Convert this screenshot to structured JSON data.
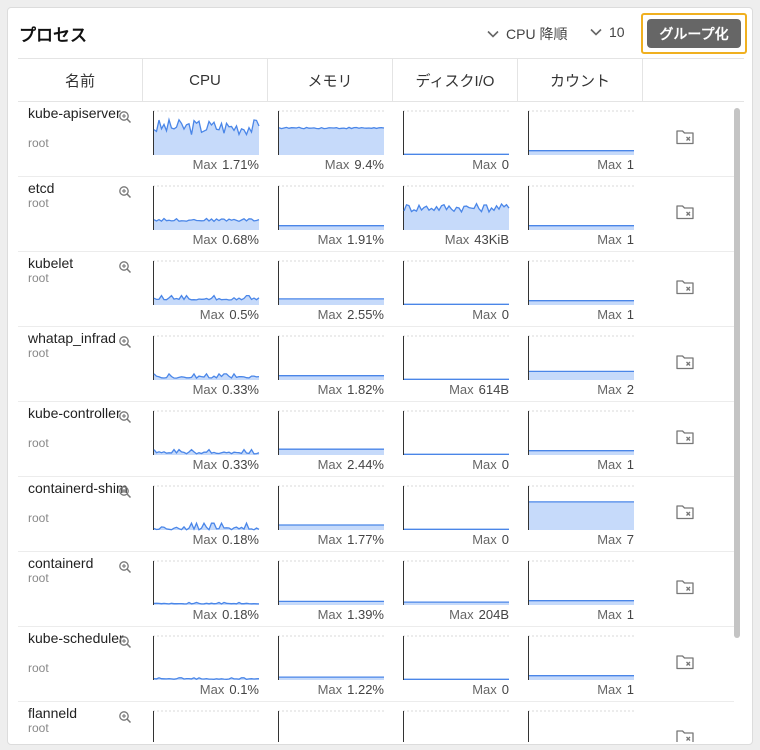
{
  "title": "プロセス",
  "sort_dropdown": "CPU 降順",
  "count_dropdown": "10",
  "group_button": "グループ化",
  "columns": [
    "名前",
    "CPU",
    "メモリ",
    "ディスクI/O",
    "カウント"
  ],
  "max_label": "Max",
  "colors": {
    "line": "#4a86e8",
    "fill": "#c6dafa",
    "highlight": "#f0b020",
    "button": "#666666"
  },
  "rows": [
    {
      "name": "kube-apiserver",
      "user": "root",
      "cpu_max": "1.71%",
      "mem_max": "9.4%",
      "disk_max": "0",
      "count_max": "1",
      "levels": {
        "cpu": 0.78,
        "mem": 0.75,
        "disk": 0.02,
        "count": 0.12
      },
      "noise": {
        "cpu": 0.22,
        "mem": 0.02,
        "disk": 0,
        "count": 0
      }
    },
    {
      "name": "etcd",
      "user": "root",
      "cpu_max": "0.68%",
      "mem_max": "1.91%",
      "disk_max": "43KiB",
      "count_max": "1",
      "levels": {
        "cpu": 0.28,
        "mem": 0.12,
        "disk": 0.62,
        "count": 0.12
      },
      "noise": {
        "cpu": 0.04,
        "mem": 0,
        "disk": 0.12,
        "count": 0
      }
    },
    {
      "name": "kubelet",
      "user": "root",
      "cpu_max": "0.5%",
      "mem_max": "2.55%",
      "disk_max": "0",
      "count_max": "1",
      "levels": {
        "cpu": 0.17,
        "mem": 0.17,
        "disk": 0.02,
        "count": 0.12
      },
      "noise": {
        "cpu": 0.03,
        "mem": 0,
        "disk": 0,
        "count": 0
      }
    },
    {
      "name": "whatap_infrad",
      "user": "root",
      "cpu_max": "0.33%",
      "mem_max": "1.82%",
      "disk_max": "614B",
      "count_max": "2",
      "levels": {
        "cpu": 0.08,
        "mem": 0.12,
        "disk": 0.02,
        "count": 0.24
      },
      "noise": {
        "cpu": 0.03,
        "mem": 0,
        "disk": 0,
        "count": 0
      }
    },
    {
      "name": "kube-controller",
      "user": "root",
      "cpu_max": "0.33%",
      "mem_max": "2.44%",
      "disk_max": "0",
      "count_max": "1",
      "levels": {
        "cpu": 0.06,
        "mem": 0.16,
        "disk": 0.02,
        "count": 0.12
      },
      "noise": {
        "cpu": 0.03,
        "mem": 0,
        "disk": 0,
        "count": 0
      }
    },
    {
      "name": "containerd-shim",
      "user": "root",
      "cpu_max": "0.18%",
      "mem_max": "1.77%",
      "disk_max": "0",
      "count_max": "7",
      "levels": {
        "cpu": 0.04,
        "mem": 0.14,
        "disk": 0.02,
        "count": 0.78
      },
      "noise": {
        "cpu": 0.05,
        "mem": 0,
        "disk": 0,
        "count": 0
      }
    },
    {
      "name": "containerd",
      "user": "root",
      "cpu_max": "0.18%",
      "mem_max": "1.39%",
      "disk_max": "204B",
      "count_max": "1",
      "levels": {
        "cpu": 0.04,
        "mem": 0.1,
        "disk": 0.08,
        "count": 0.12
      },
      "noise": {
        "cpu": 0.01,
        "mem": 0,
        "disk": 0,
        "count": 0
      }
    },
    {
      "name": "kube-scheduler",
      "user": "root",
      "cpu_max": "0.1%",
      "mem_max": "1.22%",
      "disk_max": "0",
      "count_max": "1",
      "levels": {
        "cpu": 0.03,
        "mem": 0.08,
        "disk": 0.02,
        "count": 0.12
      },
      "noise": {
        "cpu": 0.01,
        "mem": 0,
        "disk": 0,
        "count": 0
      }
    },
    {
      "name": "flanneld",
      "user": "root",
      "cpu_max": "",
      "mem_max": "",
      "disk_max": "",
      "count_max": "",
      "levels": {
        "cpu": 0.05,
        "mem": 0.08,
        "disk": 0.02,
        "count": 0.12
      },
      "noise": {
        "cpu": 0.01,
        "mem": 0,
        "disk": 0,
        "count": 0
      }
    }
  ]
}
